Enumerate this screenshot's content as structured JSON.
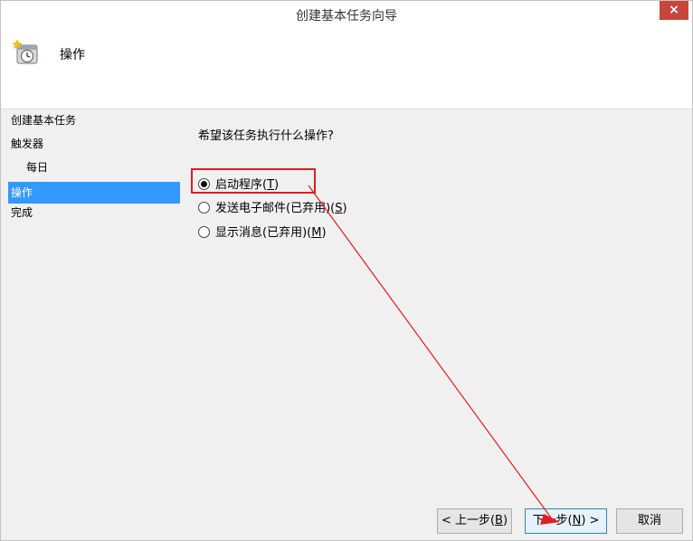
{
  "window": {
    "title": "创建基本任务向导",
    "close_glyph": "×"
  },
  "header": {
    "title": "操作",
    "icon": "task-scheduler-clock-icon"
  },
  "sidebar": {
    "items": [
      {
        "label": "创建基本任务",
        "active": false,
        "sub": false
      },
      {
        "label": "触发器",
        "active": false,
        "sub": false
      },
      {
        "label": "每日",
        "active": false,
        "sub": true
      },
      {
        "label": "操作",
        "active": true,
        "sub": false
      },
      {
        "label": "完成",
        "active": false,
        "sub": false
      }
    ]
  },
  "main": {
    "question": "希望该任务执行什么操作?",
    "options": [
      {
        "label": "启动程序(",
        "accel": "T",
        "suffix": ")",
        "checked": true
      },
      {
        "label": "发送电子邮件(已弃用)(",
        "accel": "S",
        "suffix": ")",
        "checked": false
      },
      {
        "label": "显示消息(已弃用)(",
        "accel": "M",
        "suffix": ")",
        "checked": false
      }
    ]
  },
  "buttons": {
    "back": {
      "prefix": "< 上一步(",
      "accel": "B",
      "suffix": ")"
    },
    "next": {
      "prefix": "下一步(",
      "accel": "N",
      "suffix": ") >"
    },
    "cancel": {
      "label": "取消"
    }
  },
  "annotation": {
    "color": "#e31b23"
  }
}
